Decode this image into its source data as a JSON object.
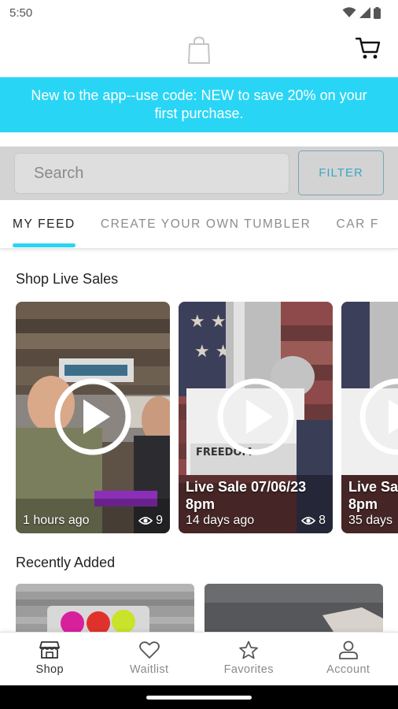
{
  "status_bar": {
    "time": "5:50"
  },
  "header": {
    "logo_icon": "shopping-bag-icon",
    "cart_icon": "cart-icon"
  },
  "promo": {
    "text": "New to the app--use code: NEW to save 20% on your first purchase.",
    "bg_color": "#29d5f5"
  },
  "search": {
    "placeholder": "Search",
    "filter_label": "FILTER"
  },
  "tabs": [
    {
      "label": "MY FEED",
      "active": true
    },
    {
      "label": "CREATE YOUR OWN TUMBLER",
      "active": false
    },
    {
      "label": "CAR F",
      "active": false
    }
  ],
  "live_sales": {
    "title": "Shop Live Sales",
    "cards": [
      {
        "title": "",
        "time": "1 hours ago",
        "views": "9"
      },
      {
        "title": "Live Sale 07/06/23\n8pm",
        "time": "14 days ago",
        "views": "8"
      },
      {
        "title": "Live Sa\n8pm",
        "time": "35 days",
        "views": ""
      }
    ]
  },
  "recently_added": {
    "title": "Recently Added"
  },
  "bottom_nav": [
    {
      "label": "Shop",
      "icon": "storefront-icon",
      "active": true
    },
    {
      "label": "Waitlist",
      "icon": "heart-icon",
      "active": false
    },
    {
      "label": "Favorites",
      "icon": "star-icon",
      "active": false
    },
    {
      "label": "Account",
      "icon": "person-icon",
      "active": false
    }
  ],
  "accent_color": "#29d5f5"
}
